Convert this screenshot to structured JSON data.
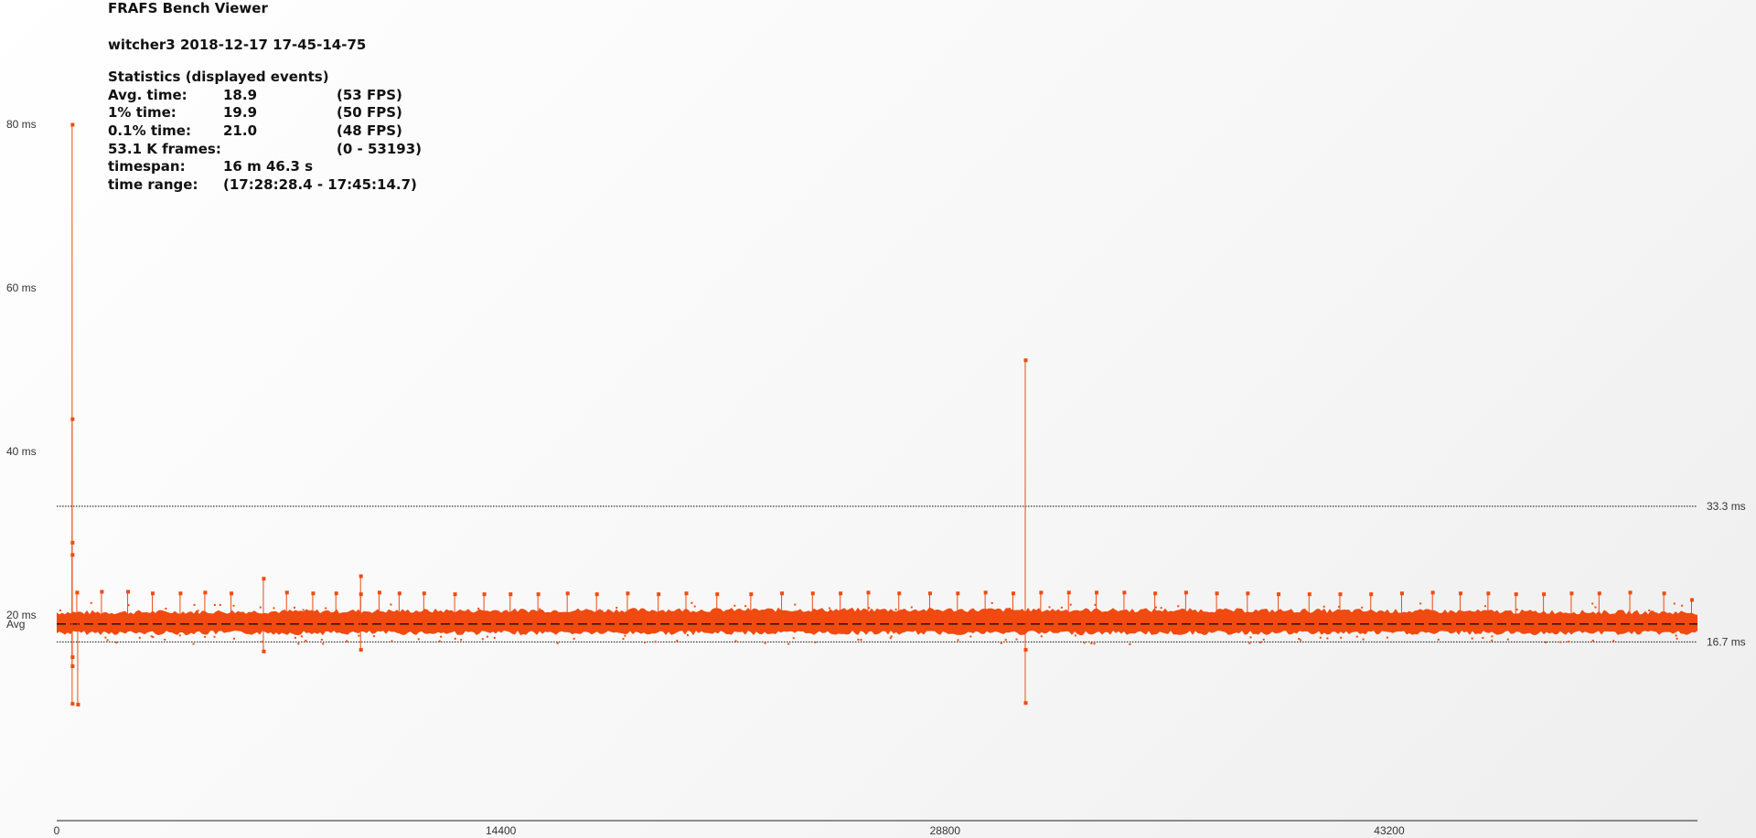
{
  "app": {
    "title": "FRAFS Bench Viewer",
    "run_name": "witcher3 2018-12-17 17-45-14-75"
  },
  "stats": {
    "heading": "Statistics (displayed events)",
    "rows": [
      {
        "label": "Avg. time:",
        "value": "18.9",
        "extra": "(53 FPS)"
      },
      {
        "label": "1% time:",
        "value": "19.9",
        "extra": "(50 FPS)"
      },
      {
        "label": "0.1% time:",
        "value": "21.0",
        "extra": "(48 FPS)"
      },
      {
        "label": "53.1 K frames:",
        "value": "",
        "extra": "(0 - 53193)"
      },
      {
        "label": "timespan:",
        "value": "16 m 46.3 s",
        "extra": ""
      },
      {
        "label": "time range:",
        "value": "(17:28:28.4 - 17:45:14.7)",
        "extra": ""
      }
    ]
  },
  "chart_data": {
    "type": "scatter",
    "title": "",
    "xlabel": "",
    "ylabel": "",
    "xlim": [
      0,
      53193
    ],
    "ylim": [
      0,
      80
    ],
    "x_ticks": [
      {
        "value": 0,
        "label": "0"
      },
      {
        "value": 14400,
        "label": "14400"
      },
      {
        "value": 28800,
        "label": "28800"
      },
      {
        "value": 43200,
        "label": "43200"
      }
    ],
    "y_ticks": [
      {
        "value": 80,
        "label": "80 ms"
      },
      {
        "value": 60,
        "label": "60 ms"
      },
      {
        "value": 40,
        "label": "40 ms"
      },
      {
        "value": 20,
        "label": "20 ms"
      }
    ],
    "avg_line": {
      "value": 18.9,
      "label": "Avg"
    },
    "reference_lines": [
      {
        "value": 33.3,
        "label": "33.3 ms"
      },
      {
        "value": 16.7,
        "label": "16.7 ms"
      }
    ],
    "series_color": "#f04a10",
    "band": {
      "low": 18.2,
      "high": 19.8
    },
    "spikes": [
      {
        "x": 500,
        "y": 80
      },
      {
        "x": 500,
        "y": 44
      },
      {
        "x": 500,
        "y": 28.9
      },
      {
        "x": 500,
        "y": 27.4
      },
      {
        "x": 500,
        "y": 14.9
      },
      {
        "x": 500,
        "y": 13.8
      },
      {
        "x": 500,
        "y": 9.2
      },
      {
        "x": 680,
        "y": 9.1
      },
      {
        "x": 6700,
        "y": 24.5
      },
      {
        "x": 6700,
        "y": 15.6
      },
      {
        "x": 9850,
        "y": 24.8
      },
      {
        "x": 9850,
        "y": 15.8
      },
      {
        "x": 9850,
        "y": 22.6
      },
      {
        "x": 31400,
        "y": 51.2
      },
      {
        "x": 31400,
        "y": 15.8
      },
      {
        "x": 31400,
        "y": 9.3
      }
    ],
    "small_flags": [
      {
        "x": 650,
        "y": 22.8
      },
      {
        "x": 1450,
        "y": 22.9
      },
      {
        "x": 2300,
        "y": 22.9
      },
      {
        "x": 3100,
        "y": 22.7
      },
      {
        "x": 4000,
        "y": 22.7
      },
      {
        "x": 4800,
        "y": 22.8
      },
      {
        "x": 5650,
        "y": 22.7
      },
      {
        "x": 7450,
        "y": 22.8
      },
      {
        "x": 8300,
        "y": 22.7
      },
      {
        "x": 9050,
        "y": 22.7
      },
      {
        "x": 10450,
        "y": 22.8
      },
      {
        "x": 11100,
        "y": 22.7
      },
      {
        "x": 11900,
        "y": 22.7
      },
      {
        "x": 12900,
        "y": 22.6
      },
      {
        "x": 13850,
        "y": 22.6
      },
      {
        "x": 14700,
        "y": 22.6
      },
      {
        "x": 15600,
        "y": 22.6
      },
      {
        "x": 16550,
        "y": 22.7
      },
      {
        "x": 17500,
        "y": 22.6
      },
      {
        "x": 18500,
        "y": 22.7
      },
      {
        "x": 19500,
        "y": 22.6
      },
      {
        "x": 20400,
        "y": 22.7
      },
      {
        "x": 21400,
        "y": 22.6
      },
      {
        "x": 22500,
        "y": 22.6
      },
      {
        "x": 23500,
        "y": 22.7
      },
      {
        "x": 24500,
        "y": 22.7
      },
      {
        "x": 25400,
        "y": 22.7
      },
      {
        "x": 26300,
        "y": 22.8
      },
      {
        "x": 27300,
        "y": 22.7
      },
      {
        "x": 28300,
        "y": 22.7
      },
      {
        "x": 29200,
        "y": 22.7
      },
      {
        "x": 30100,
        "y": 22.8
      },
      {
        "x": 31000,
        "y": 22.7
      },
      {
        "x": 31900,
        "y": 22.8
      },
      {
        "x": 32800,
        "y": 22.8
      },
      {
        "x": 33700,
        "y": 22.8
      },
      {
        "x": 34600,
        "y": 22.8
      },
      {
        "x": 35600,
        "y": 22.7
      },
      {
        "x": 36600,
        "y": 22.8
      },
      {
        "x": 37600,
        "y": 22.7
      },
      {
        "x": 38600,
        "y": 22.7
      },
      {
        "x": 39600,
        "y": 22.6
      },
      {
        "x": 40600,
        "y": 22.6
      },
      {
        "x": 41600,
        "y": 22.6
      },
      {
        "x": 42600,
        "y": 22.6
      },
      {
        "x": 43600,
        "y": 22.7
      },
      {
        "x": 44600,
        "y": 22.8
      },
      {
        "x": 45500,
        "y": 22.7
      },
      {
        "x": 46400,
        "y": 22.7
      },
      {
        "x": 47300,
        "y": 22.6
      },
      {
        "x": 48200,
        "y": 22.6
      },
      {
        "x": 49100,
        "y": 22.7
      },
      {
        "x": 50000,
        "y": 22.7
      },
      {
        "x": 51000,
        "y": 22.8
      },
      {
        "x": 52100,
        "y": 22.7
      },
      {
        "x": 53000,
        "y": 21.9
      }
    ]
  }
}
